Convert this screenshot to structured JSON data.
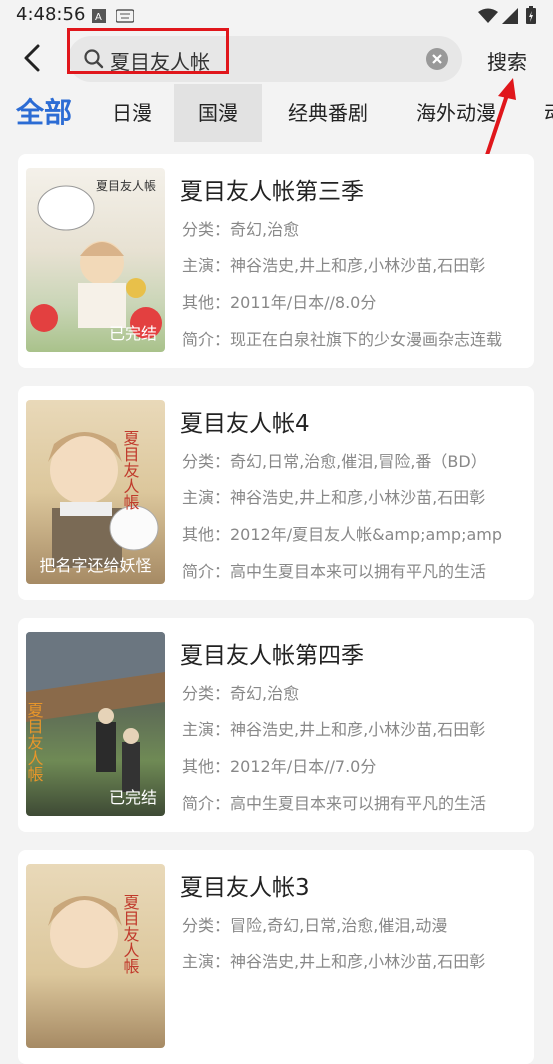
{
  "status_bar": {
    "time": "4:48:56"
  },
  "search": {
    "query": "夏目友人帐",
    "button_label": "搜索"
  },
  "tabs": [
    {
      "label": "全部"
    },
    {
      "label": "日漫"
    },
    {
      "label": "国漫"
    },
    {
      "label": "经典番剧"
    },
    {
      "label": "海外动漫"
    },
    {
      "label": "动"
    }
  ],
  "results": [
    {
      "title": "夏目友人帐第三季",
      "badge": "已完结",
      "category": "分类：奇幻,治愈",
      "cast": "主演：神谷浩史,井上和彦,小林沙苗,石田彰",
      "other": "其他：2011年/日本//8.0分",
      "intro": "简介：现正在白泉社旗下的少女漫画杂志连载"
    },
    {
      "title": "夏目友人帐4",
      "badge": "把名字还给妖怪",
      "category": "分类：奇幻,日常,治愈,催泪,冒险,番（BD）",
      "cast": "主演：神谷浩史,井上和彦,小林沙苗,石田彰",
      "other": "其他：2012年/夏目友人帐&amp;amp;amp",
      "intro": "简介：高中生夏目本来可以拥有平凡的生活"
    },
    {
      "title": "夏目友人帐第四季",
      "badge": "已完结",
      "category": "分类：奇幻,治愈",
      "cast": "主演：神谷浩史,井上和彦,小林沙苗,石田彰",
      "other": "其他：2012年/日本//7.0分",
      "intro": "简介：高中生夏目本来可以拥有平凡的生活"
    },
    {
      "title": "夏目友人帐3",
      "badge": "",
      "category": "分类：冒险,奇幻,日常,治愈,催泪,动漫",
      "cast": "主演：神谷浩史,井上和彦,小林沙苗,石田彰",
      "other": "",
      "intro": ""
    }
  ],
  "colors": {
    "accent": "#2c6cd4",
    "annotation_red": "#e0161b"
  }
}
